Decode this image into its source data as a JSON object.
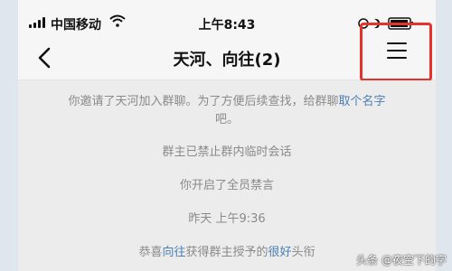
{
  "status_bar": {
    "carrier": "中国移动",
    "time": "上午8:43"
  },
  "nav": {
    "title": "天河、向往(2)",
    "back_icon": "chevron-left-icon",
    "menu_icon": "hamburger-menu-icon",
    "highlight_color": "#e5322d"
  },
  "messages": {
    "invite_prefix": "你邀请了天河加入群聊。为了方便后续查找，给群聊",
    "invite_link": "取个名字",
    "invite_suffix": "吧。",
    "temp_chat_disabled": "群主已禁止群内临时会话",
    "all_muted": "你开启了全员禁言",
    "timestamp": "昨天 上午9:36",
    "congrats_prefix": "恭喜",
    "congrats_name": "向往",
    "congrats_middle": "获得群主授予的",
    "congrats_title": "很好",
    "congrats_suffix": "头衔"
  },
  "watermark": "头条 @夜空下的字",
  "colors": {
    "link": "#4b7fb3",
    "system_text": "#8a8a8a",
    "chat_bg": "#ececec"
  }
}
